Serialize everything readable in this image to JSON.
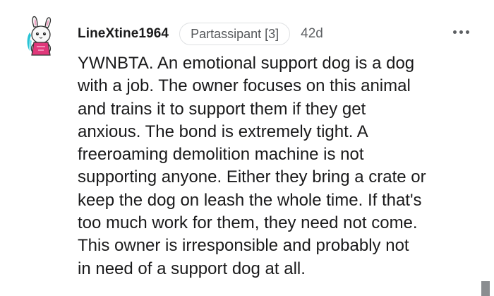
{
  "comment": {
    "author": "LineXtine1964",
    "flair": "Partassipant [3]",
    "age": "42d",
    "body_lines": [
      "YWNBTA. An emotional support dog is a dog",
      "with a job. The owner focuses on this animal",
      "and trains it to support them if they get",
      "anxious. The bond is extremely tight. A",
      "freeroaming demolition machine is not",
      "supporting anyone. Either they bring a crate or",
      "keep the dog on leash the whole time. If that's",
      "too much work for them, they need not come.",
      "This owner is irresponsible and probably not",
      "in need of a support dog at all."
    ]
  },
  "icons": {
    "avatar": "bunny-avatar-icon",
    "more": "more-options-icon"
  },
  "colors": {
    "text": "#1a1a1b",
    "muted": "#5c5f62",
    "badge_border": "#dfe1e3",
    "avatar_accent": "#e0387a",
    "avatar_hair": "#29c4d6"
  }
}
